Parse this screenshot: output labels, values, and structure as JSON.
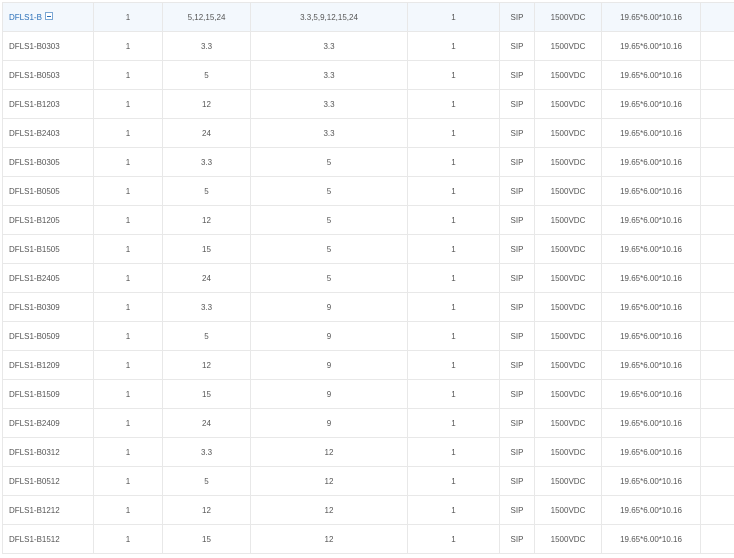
{
  "parent": {
    "model": "DFLS1-B",
    "power": "1",
    "vin": "5,12,15,24",
    "vout": "3.3,5,9,12,15,24",
    "outputs": "1",
    "package": "SIP",
    "isolation": "1500VDC",
    "size": "19.65*6.00*10.16"
  },
  "rows": [
    [
      "DFLS1-B0303",
      "1",
      "3.3",
      "3.3",
      "1",
      "SIP",
      "1500VDC",
      "19.65*6.00*10.16"
    ],
    [
      "DFLS1-B0503",
      "1",
      "5",
      "3.3",
      "1",
      "SIP",
      "1500VDC",
      "19.65*6.00*10.16"
    ],
    [
      "DFLS1-B1203",
      "1",
      "12",
      "3.3",
      "1",
      "SIP",
      "1500VDC",
      "19.65*6.00*10.16"
    ],
    [
      "DFLS1-B2403",
      "1",
      "24",
      "3.3",
      "1",
      "SIP",
      "1500VDC",
      "19.65*6.00*10.16"
    ],
    [
      "DFLS1-B0305",
      "1",
      "3.3",
      "5",
      "1",
      "SIP",
      "1500VDC",
      "19.65*6.00*10.16"
    ],
    [
      "DFLS1-B0505",
      "1",
      "5",
      "5",
      "1",
      "SIP",
      "1500VDC",
      "19.65*6.00*10.16"
    ],
    [
      "DFLS1-B1205",
      "1",
      "12",
      "5",
      "1",
      "SIP",
      "1500VDC",
      "19.65*6.00*10.16"
    ],
    [
      "DFLS1-B1505",
      "1",
      "15",
      "5",
      "1",
      "SIP",
      "1500VDC",
      "19.65*6.00*10.16"
    ],
    [
      "DFLS1-B2405",
      "1",
      "24",
      "5",
      "1",
      "SIP",
      "1500VDC",
      "19.65*6.00*10.16"
    ],
    [
      "DFLS1-B0309",
      "1",
      "3.3",
      "9",
      "1",
      "SIP",
      "1500VDC",
      "19.65*6.00*10.16"
    ],
    [
      "DFLS1-B0509",
      "1",
      "5",
      "9",
      "1",
      "SIP",
      "1500VDC",
      "19.65*6.00*10.16"
    ],
    [
      "DFLS1-B1209",
      "1",
      "12",
      "9",
      "1",
      "SIP",
      "1500VDC",
      "19.65*6.00*10.16"
    ],
    [
      "DFLS1-B1509",
      "1",
      "15",
      "9",
      "1",
      "SIP",
      "1500VDC",
      "19.65*6.00*10.16"
    ],
    [
      "DFLS1-B2409",
      "1",
      "24",
      "9",
      "1",
      "SIP",
      "1500VDC",
      "19.65*6.00*10.16"
    ],
    [
      "DFLS1-B0312",
      "1",
      "3.3",
      "12",
      "1",
      "SIP",
      "1500VDC",
      "19.65*6.00*10.16"
    ],
    [
      "DFLS1-B0512",
      "1",
      "5",
      "12",
      "1",
      "SIP",
      "1500VDC",
      "19.65*6.00*10.16"
    ],
    [
      "DFLS1-B1212",
      "1",
      "12",
      "12",
      "1",
      "SIP",
      "1500VDC",
      "19.65*6.00*10.16"
    ],
    [
      "DFLS1-B1512",
      "1",
      "15",
      "12",
      "1",
      "SIP",
      "1500VDC",
      "19.65*6.00*10.16"
    ]
  ]
}
